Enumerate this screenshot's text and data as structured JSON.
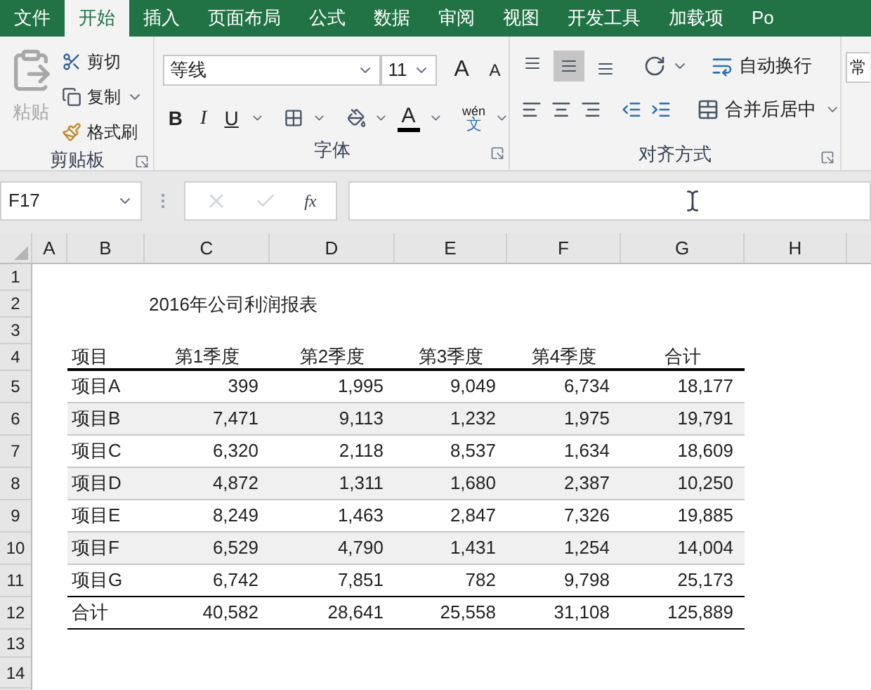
{
  "ribbon_tabs": [
    {
      "label": "文件",
      "selected": false
    },
    {
      "label": "开始",
      "selected": true
    },
    {
      "label": "插入",
      "selected": false
    },
    {
      "label": "页面布局",
      "selected": false
    },
    {
      "label": "公式",
      "selected": false
    },
    {
      "label": "数据",
      "selected": false
    },
    {
      "label": "审阅",
      "selected": false
    },
    {
      "label": "视图",
      "selected": false
    },
    {
      "label": "开发工具",
      "selected": false
    },
    {
      "label": "加载项",
      "selected": false
    },
    {
      "label": "Po",
      "selected": false
    }
  ],
  "clipboard": {
    "label": "剪贴板",
    "paste": {
      "label": "粘贴",
      "disabled": true
    },
    "cut": "剪切",
    "copy": "复制",
    "format_painter": "格式刷"
  },
  "font": {
    "label": "字体",
    "font_name": "等线",
    "font_size": "11",
    "grow": "A",
    "shrink": "A",
    "bold": "B",
    "italic": "I",
    "underline": "U",
    "font_color": "A",
    "phonetic_top": "wén",
    "phonetic_bottom": "文"
  },
  "alignment": {
    "label": "对齐方式",
    "vertical": [
      {
        "kind": "top",
        "selected": false
      },
      {
        "kind": "middle",
        "selected": true
      },
      {
        "kind": "bottom",
        "selected": false
      }
    ],
    "wrap_text": "自动换行",
    "merge_center": "合并后居中"
  },
  "number": {
    "format": "常"
  },
  "formula_bar": {
    "name_box": "F17",
    "fx": "fx"
  },
  "columns": [
    "A",
    "B",
    "C",
    "D",
    "E",
    "F",
    "G",
    "H"
  ],
  "rows": [
    "1",
    "2",
    "3",
    "4",
    "5",
    "6",
    "7",
    "8",
    "9",
    "10",
    "11",
    "12",
    "13",
    "14"
  ],
  "title": "2016年公司利润报表",
  "table_header": [
    "项目",
    "第1季度",
    "第2季度",
    "第3季度",
    "第4季度",
    "合计"
  ],
  "table_rows": [
    [
      "项目A",
      "399",
      "1,995",
      "9,049",
      "6,734",
      "18,177"
    ],
    [
      "项目B",
      "7,471",
      "9,113",
      "1,232",
      "1,975",
      "19,791"
    ],
    [
      "项目C",
      "6,320",
      "2,118",
      "8,537",
      "1,634",
      "18,609"
    ],
    [
      "项目D",
      "4,872",
      "1,311",
      "1,680",
      "2,387",
      "10,250"
    ],
    [
      "项目E",
      "8,249",
      "1,463",
      "2,847",
      "7,326",
      "19,885"
    ],
    [
      "项目F",
      "6,529",
      "4,790",
      "1,431",
      "1,254",
      "14,004"
    ],
    [
      "项目G",
      "6,742",
      "7,851",
      "782",
      "9,798",
      "25,173"
    ]
  ],
  "total_row": [
    "合计",
    "40,582",
    "28,641",
    "25,558",
    "31,108",
    "125,889"
  ]
}
